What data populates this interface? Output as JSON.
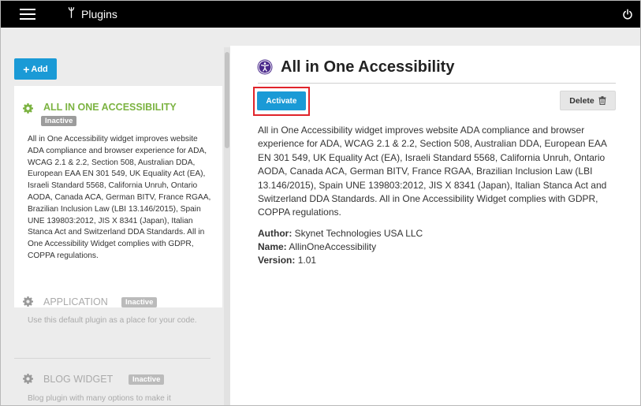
{
  "app": {
    "title": "Plugins",
    "logo_glyph": "ᛘ"
  },
  "toolbar": {
    "add_label": "Add"
  },
  "plugins": [
    {
      "name": "ALL IN ONE ACCESSIBILITY",
      "status": "Inactive",
      "description": "All in One Accessibility widget improves website ADA compliance and browser experience for ADA, WCAG 2.1 & 2.2, Section 508, Australian DDA, European EAA EN 301 549, UK Equality Act (EA), Israeli Standard 5568, California Unruh, Ontario AODA, Canada ACA, German BITV, France RGAA, Brazilian Inclusion Law (LBI 13.146/2015), Spain UNE 139803:2012, JIS X 8341 (Japan), Italian Stanca Act and Switzerland DDA Standards. All in One Accessibility Widget complies with GDPR, COPPA regulations.",
      "selected": true
    },
    {
      "name": "APPLICATION",
      "status": "Inactive",
      "description": "Use this default plugin as a place for your code.",
      "selected": false
    },
    {
      "name": "BLOG WIDGET",
      "status": "Inactive",
      "description": "Blog plugin with many options to make it",
      "selected": false
    }
  ],
  "detail": {
    "title": "All in One Accessibility",
    "activate_label": "Activate",
    "delete_label": "Delete",
    "description": "All in One Accessibility widget improves website ADA compliance and browser experience for ADA, WCAG 2.1 & 2.2, Section 508, Australian DDA, European EAA EN 301 549, UK Equality Act (EA), Israeli Standard 5568, California Unruh, Ontario AODA, Canada ACA, German BITV, France RGAA, Brazilian Inclusion Law (LBI 13.146/2015), Spain UNE 139803:2012, JIS X 8341 (Japan), Italian Stanca Act and Switzerland DDA Standards. All in One Accessibility Widget complies with GDPR, COPPA regulations.",
    "author_label": "Author:",
    "author": "Skynet Technologies USA LLC",
    "name_label": "Name:",
    "name": "AllinOneAccessibility",
    "version_label": "Version:",
    "version": "1.01"
  },
  "colors": {
    "accent": "#1a9ad6",
    "active_title": "#7cb342",
    "highlight": "#e0242b",
    "a11y_icon": "#4b2a8c"
  },
  "icons": {
    "menu": "hamburger-icon",
    "power": "power-icon",
    "gear": "gear-icon",
    "accessibility": "accessibility-icon",
    "trash": "trash-icon"
  }
}
